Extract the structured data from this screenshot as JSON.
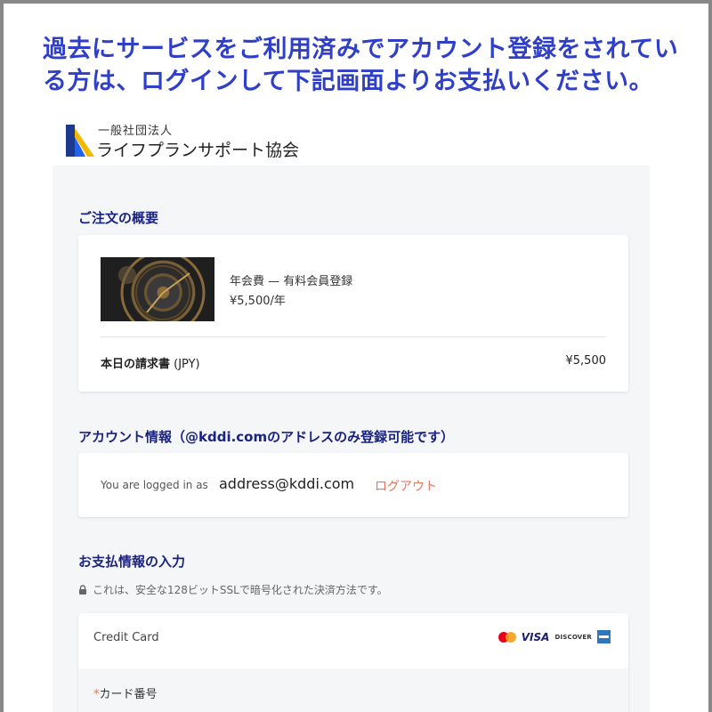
{
  "notice": {
    "text": "過去にサービスをご利用済みでアカウント登録をされている方は、ログインして下記画面よりお支払いください。"
  },
  "logo": {
    "subtitle": "一般社団法人",
    "name": "ライフプランサポート協会"
  },
  "order_summary": {
    "title": "ご注文の概要",
    "product_name": "年会費 — 有料会員登録",
    "product_price": "¥5,500/年",
    "total_label": "本日の請求書",
    "total_currency": "(JPY)",
    "total_value": "¥5,500"
  },
  "account": {
    "title": "アカウント情報（@kddi.comのアドレスのみ登録可能です）",
    "logged_in_text": "You are logged in as",
    "email": "address@kddi.com",
    "logout_label": "ログアウト"
  },
  "payment": {
    "title": "お支払情報の入力",
    "secure_text": "これは、安全な128ビットSSLで暗号化された決済方法です。",
    "method_label": "Credit Card",
    "brands": [
      "mastercard",
      "VISA",
      "DISCOVER",
      "amex"
    ],
    "visa_label": "VISA",
    "discover_label": "DISCOVER",
    "card_number_label": "カード番号",
    "required_mark": "*"
  },
  "colors": {
    "notice": "#2f3fc8",
    "section_title": "#1a237e",
    "logout": "#e8735a",
    "panel_bg": "#f5f6f8"
  },
  "icons": {
    "logo": "logo-mark-icon",
    "lock": "lock-icon",
    "mastercard": "mastercard-icon",
    "amex": "amex-icon"
  }
}
